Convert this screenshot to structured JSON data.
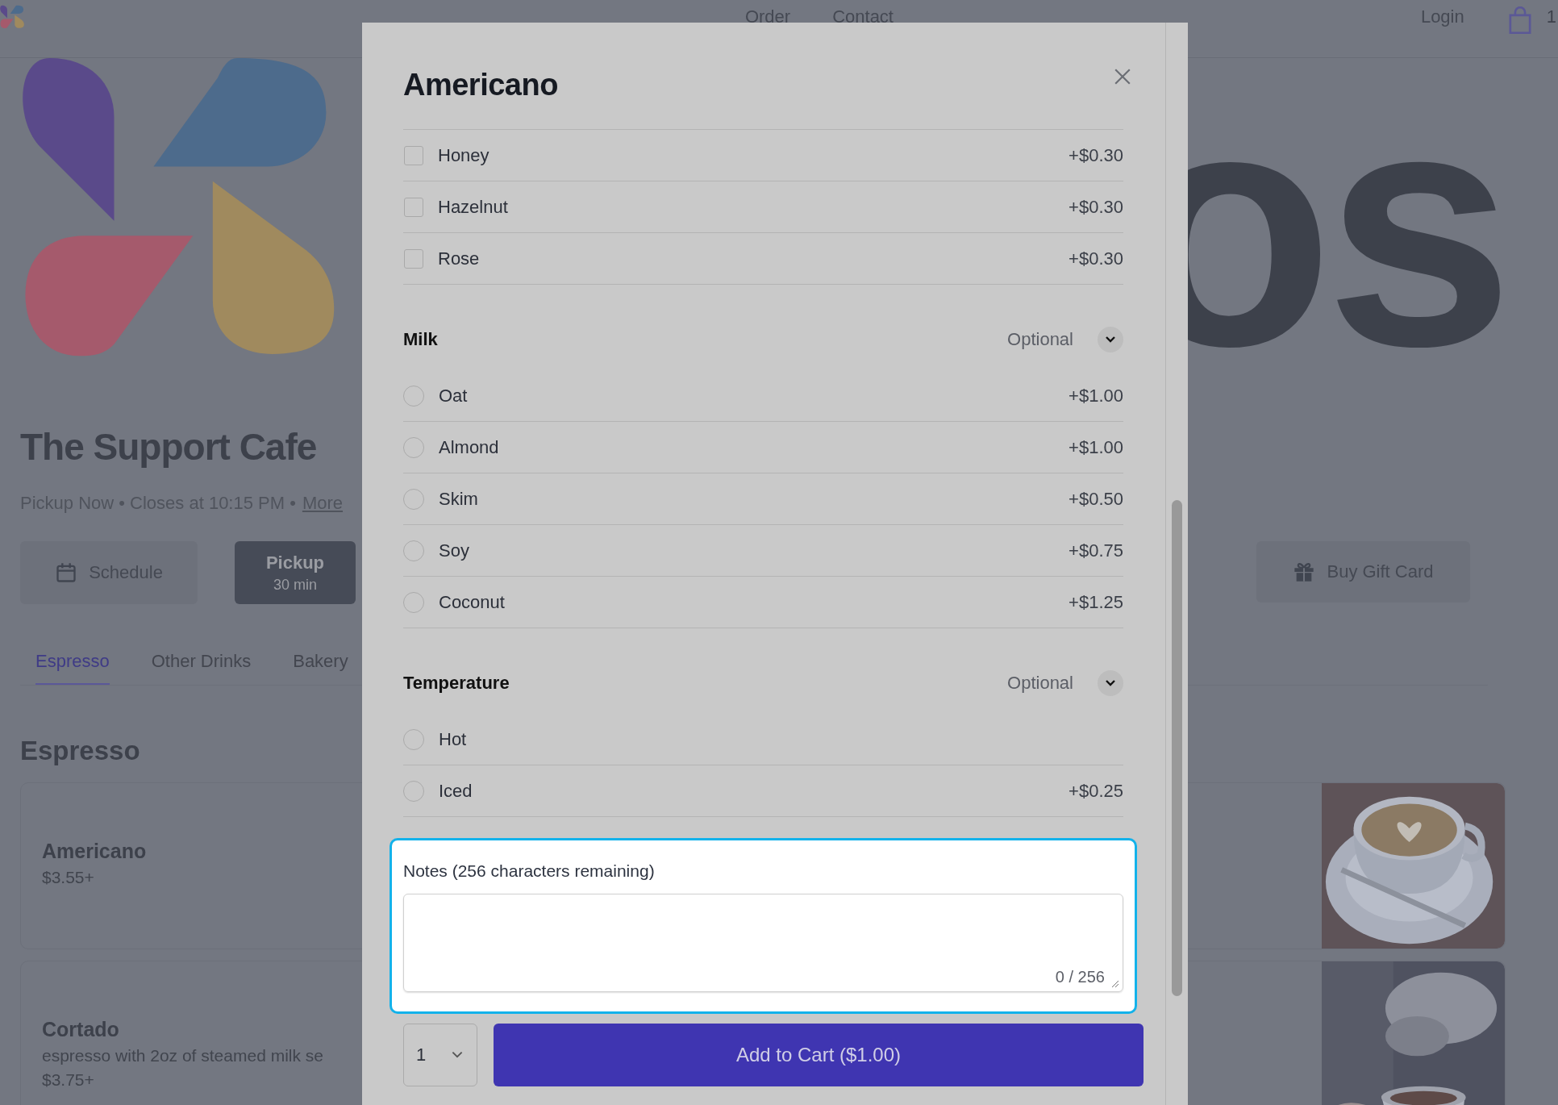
{
  "nav": {
    "links": [
      {
        "label": "Order"
      },
      {
        "label": "Contact"
      }
    ],
    "login": "Login",
    "cart_count": "1"
  },
  "hero": {
    "wordmark": "os"
  },
  "store": {
    "name": "The Support Cafe",
    "status": "Pickup Now • Closes at 10:15 PM •",
    "more_link": "More"
  },
  "order_modes": [
    {
      "kind": "schedule",
      "label": "Schedule",
      "selected": false
    },
    {
      "kind": "pickup",
      "label": "Pickup",
      "sub": "30 min",
      "selected": true
    }
  ],
  "gift_card": "Buy Gift Card",
  "category_tabs": [
    {
      "label": "Espresso",
      "selected": true
    },
    {
      "label": "Other Drinks",
      "selected": false
    },
    {
      "label": "Bakery",
      "selected": false
    }
  ],
  "section_title": "Espresso",
  "menu_items": [
    {
      "name": "Americano",
      "price": "$3.55+"
    },
    {
      "name": "Cortado",
      "description": "espresso with 2oz of steamed milk se",
      "price": "$3.75+"
    }
  ],
  "modal": {
    "title": "Americano",
    "groups": [
      {
        "kind": "checkbox",
        "options": [
          {
            "label": "Honey",
            "price": "+$0.30",
            "checked": false
          },
          {
            "label": "Hazelnut",
            "price": "+$0.30",
            "checked": false
          },
          {
            "label": "Rose",
            "price": "+$0.30",
            "checked": false
          }
        ]
      },
      {
        "kind": "radio",
        "title": "Milk",
        "badge": "Optional",
        "options": [
          {
            "label": "Oat",
            "price": "+$1.00",
            "selected": false
          },
          {
            "label": "Almond",
            "price": "+$1.00",
            "selected": false
          },
          {
            "label": "Skim",
            "price": "+$0.50",
            "selected": false
          },
          {
            "label": "Soy",
            "price": "+$0.75",
            "selected": false
          },
          {
            "label": "Coconut",
            "price": "+$1.25",
            "selected": false
          }
        ]
      },
      {
        "kind": "radio",
        "title": "Temperature",
        "badge": "Optional",
        "options": [
          {
            "label": "Hot",
            "selected": false
          },
          {
            "label": "Iced",
            "price": "+$0.25",
            "selected": false
          }
        ]
      }
    ],
    "notes": {
      "label": "Notes (256 characters remaining)",
      "counter": "0 / 256",
      "highlighted": true
    },
    "quantity": "1",
    "add_button": "Add to Cart ($1.00)"
  }
}
